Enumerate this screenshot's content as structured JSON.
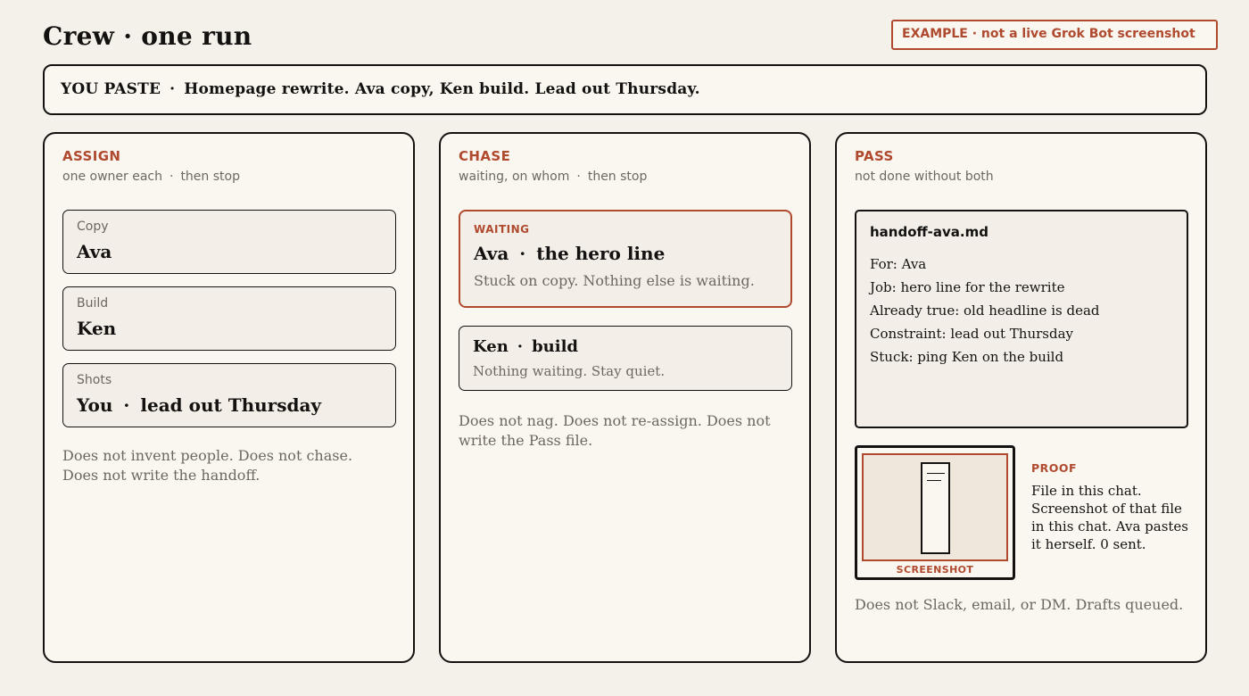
{
  "header": {
    "title": "Crew · one run",
    "example_badge": "EXAMPLE · not a live Grok Bot screenshot"
  },
  "paste": {
    "label": "YOU PASTE",
    "separator": "·",
    "text": "Homepage rewrite. Ava copy, Ken build. Lead out Thursday."
  },
  "assign": {
    "heading": "ASSIGN",
    "sub_a": "one owner each",
    "sub_dot": "·",
    "sub_b": "then stop",
    "cards": [
      {
        "label": "Copy",
        "value": "Ava"
      },
      {
        "label": "Build",
        "value": "Ken"
      },
      {
        "label": "Shots",
        "value_a": "You",
        "dot": "·",
        "value_b": "lead out Thursday"
      }
    ],
    "note": "Does not invent people. Does not chase. Does not write the handoff."
  },
  "chase": {
    "heading": "CHASE",
    "sub_a": "waiting, on whom",
    "sub_dot": "·",
    "sub_b": "then stop",
    "waiting": {
      "tag": "WAITING",
      "who": "Ava",
      "dot": "·",
      "what": "the hero line",
      "desc": "Stuck on copy. Nothing else is waiting."
    },
    "quiet": {
      "who": "Ken",
      "dot": "·",
      "what": "build",
      "desc": "Nothing waiting. Stay quiet."
    },
    "note": "Does not nag. Does not re-assign. Does not write the Pass file."
  },
  "pass": {
    "heading": "PASS",
    "sub": "not done without both",
    "file": {
      "name": "handoff-ava.md",
      "lines": [
        "For: Ava",
        "Job: hero line for the rewrite",
        "Already true: old headline is dead",
        "Constraint: lead out Thursday",
        "Stuck: ping Ken on the build"
      ]
    },
    "screenshot_caption": "SCREENSHOT",
    "proof_heading": "PROOF",
    "proof_text": "File in this chat. Screenshot of that file in this chat. Ava pastes it herself. 0 sent.",
    "note": "Does not Slack, email, or DM. Drafts queued."
  },
  "colors": {
    "accent": "#b04a2f",
    "ink": "#141210",
    "muted": "#6e6760",
    "background": "#f4f0ea",
    "panel": "#faf7f1"
  }
}
